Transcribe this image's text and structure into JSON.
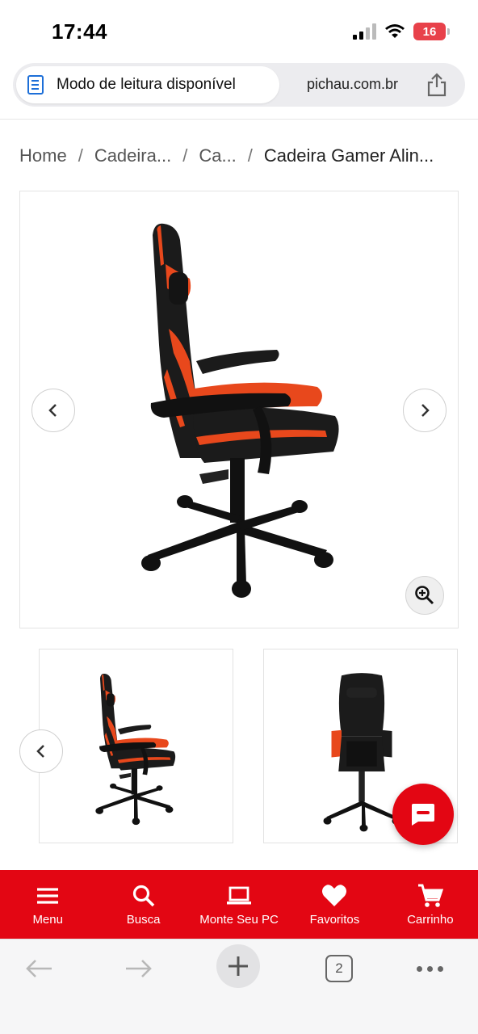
{
  "status_bar": {
    "time": "17:44",
    "battery": "16"
  },
  "address_bar": {
    "reader_mode_label": "Modo de leitura disponível",
    "domain": "pichau.com.br"
  },
  "breadcrumb": {
    "items": [
      "Home",
      "Cadeira...",
      "Ca...",
      "Cadeira Gamer Alin..."
    ],
    "separator": "/"
  },
  "gallery": {
    "main_image": "gaming-chair-side-view",
    "thumbnails": [
      "gaming-chair-side-view",
      "gaming-chair-back-view"
    ]
  },
  "bottom_nav": {
    "items": [
      {
        "label": "Menu",
        "icon": "menu-icon"
      },
      {
        "label": "Busca",
        "icon": "search-icon"
      },
      {
        "label": "Monte Seu PC",
        "icon": "laptop-icon"
      },
      {
        "label": "Favoritos",
        "icon": "heart-icon"
      },
      {
        "label": "Carrinho",
        "icon": "cart-icon"
      }
    ]
  },
  "browser_toolbar": {
    "tab_count": "2"
  },
  "colors": {
    "brand_red": "#e30613",
    "chair_orange": "#e8481c",
    "reader_blue": "#1d6fd8"
  }
}
